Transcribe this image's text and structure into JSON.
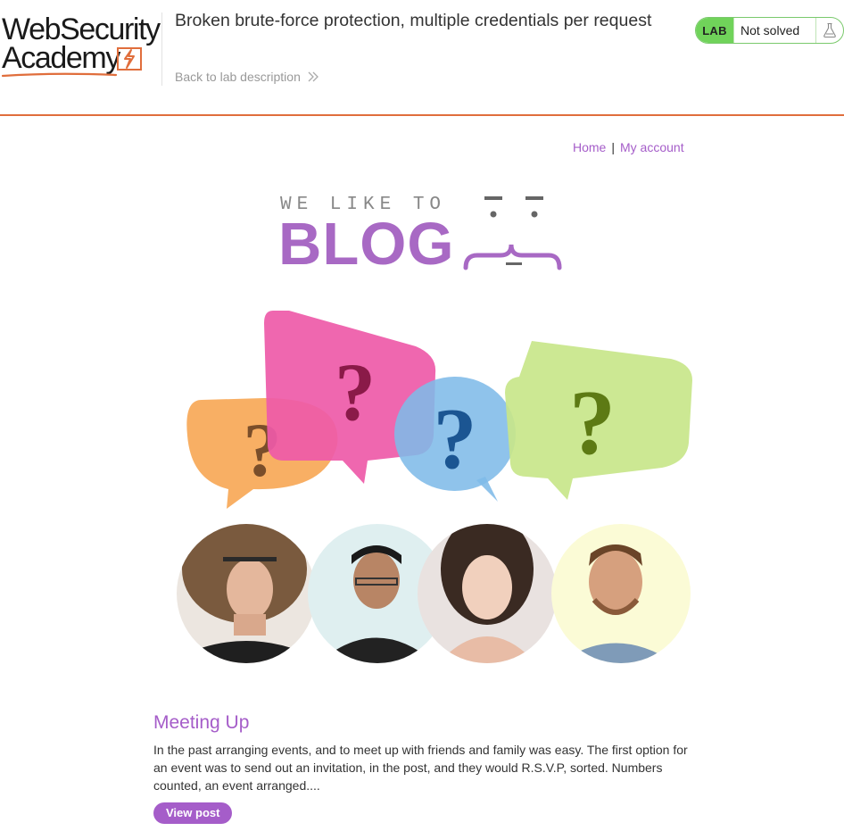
{
  "header": {
    "logo_line1": "WebSecurity",
    "logo_line2": "Academy",
    "lab_title": "Broken brute-force protection, multiple credentials per request",
    "back_link": "Back to lab description",
    "status_badge": "LAB",
    "status_text": "Not solved",
    "accent_color": "#e06e3c",
    "status_color": "#70d35a"
  },
  "nav": {
    "home": "Home",
    "separator": "|",
    "my_account": "My account"
  },
  "banner": {
    "tagline": "WE LIKE TO",
    "word": "BLOG",
    "brand_color": "#a869c4"
  },
  "hero": {
    "bubbles": [
      {
        "color": "#f7a857",
        "mark": "?"
      },
      {
        "color": "#ee5aa8",
        "mark": "?"
      },
      {
        "color": "#7fbbe8",
        "mark": "?"
      },
      {
        "color": "#c8e68a",
        "mark": "?"
      }
    ],
    "people": [
      "person-1",
      "person-2",
      "person-3",
      "person-4"
    ]
  },
  "posts": [
    {
      "title": "Meeting Up",
      "excerpt": "In the past arranging events, and to meet up with friends and family was easy. The first option for an event was to send out an invitation, in the post, and they would R.S.V.P, sorted. Numbers counted, an event arranged....",
      "button": "View post"
    }
  ]
}
